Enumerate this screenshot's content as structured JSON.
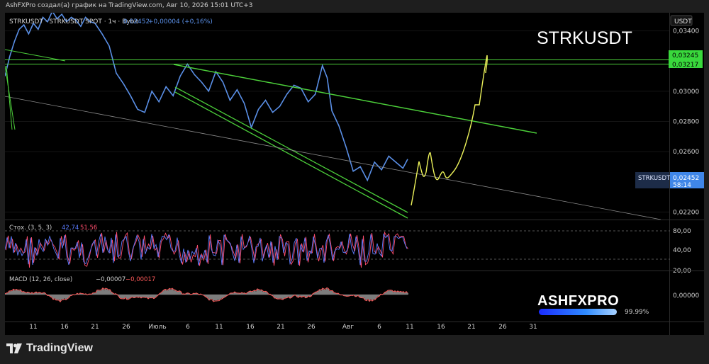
{
  "caption": "AshFXPro создал(а) график на TradingView.com, Авг 10, 2026 15:01 UTC+3",
  "header": {
    "symbol": "STRKUSDT · STRKUSDT SPOT · 1ч · Bybit",
    "last": "0,02452",
    "change": "+0,00004 (+0,16%)"
  },
  "big_title": "STRKUSDT",
  "currency": "USDT",
  "price_badge": {
    "symbol": "STRKUSDT",
    "price": "0,02452",
    "countdown": "58:14"
  },
  "level_labels": [
    "0,03245",
    "0,03217"
  ],
  "stoch": {
    "label": "Стох. (3, 5, 3)",
    "k": "42,74",
    "d": "51,56",
    "levels": [
      "80,00",
      "40,00",
      "20,00"
    ]
  },
  "macd": {
    "label": "MACD (12, 26, close)",
    "v1": "−0,00007",
    "v2": "−0,00017",
    "levels": [
      "0,00000"
    ]
  },
  "brand": {
    "text": "ASHFXPRO",
    "pct": "99.99%"
  },
  "logo_text": "TradingView",
  "colors": {
    "price": "#5a8fe6",
    "trend": "#4ccf3a",
    "projection": "#ecf25a",
    "stoch_k": "#5b7cff",
    "stoch_d": "#ff4d6d",
    "macd": "#ff5a5a"
  },
  "chart_data": {
    "type": "line",
    "title": "STRKUSDT",
    "x_ticks": [
      "11",
      "16",
      "21",
      "26",
      "Июль",
      "6",
      "11",
      "16",
      "21",
      "26",
      "Авг",
      "6",
      "11",
      "16",
      "21",
      "26",
      "31"
    ],
    "y_ticks": [
      0.034,
      0.03,
      0.028,
      0.026,
      0.022
    ],
    "y_tick_labels": [
      "0,03400",
      "0,03000",
      "0,02800",
      "0,02600",
      "0,02200"
    ],
    "ylim": [
      0.0215,
      0.0352
    ],
    "xlim": [
      0,
      34
    ],
    "series": [
      {
        "values": [
          [
            0,
            0.031
          ],
          [
            0.4,
            0.0323
          ],
          [
            0.8,
            0.0333
          ],
          [
            1.2,
            0.0341
          ],
          [
            1.6,
            0.0344
          ],
          [
            2,
            0.0338
          ],
          [
            2.4,
            0.0345
          ],
          [
            2.8,
            0.0341
          ],
          [
            3.2,
            0.0349
          ],
          [
            3.6,
            0.0346
          ],
          [
            4,
            0.0353
          ],
          [
            4.4,
            0.0348
          ],
          [
            4.8,
            0.0351
          ],
          [
            5.2,
            0.0346
          ],
          [
            5.6,
            0.0349
          ],
          [
            6,
            0.0347
          ],
          [
            6.4,
            0.0343
          ],
          [
            6.8,
            0.0349
          ],
          [
            7.2,
            0.0346
          ],
          [
            7.6,
            0.0345
          ],
          [
            8.2,
            0.0338
          ],
          [
            8.8,
            0.033
          ],
          [
            9.4,
            0.0312
          ],
          [
            10,
            0.0305
          ],
          [
            10.6,
            0.0297
          ],
          [
            11.2,
            0.0288
          ],
          [
            11.8,
            0.0286
          ],
          [
            12.4,
            0.03
          ],
          [
            13,
            0.0293
          ],
          [
            13.6,
            0.0303
          ],
          [
            14.2,
            0.0297
          ],
          [
            14.8,
            0.031
          ],
          [
            15.4,
            0.0318
          ],
          [
            16,
            0.0311
          ],
          [
            16.6,
            0.0306
          ],
          [
            17.2,
            0.03
          ],
          [
            17.8,
            0.0313
          ],
          [
            18.4,
            0.0306
          ],
          [
            19,
            0.0294
          ],
          [
            19.6,
            0.0301
          ],
          [
            20.2,
            0.0292
          ],
          [
            20.8,
            0.0276
          ],
          [
            21.4,
            0.0288
          ],
          [
            22,
            0.0294
          ],
          [
            22.6,
            0.0286
          ],
          [
            23.2,
            0.029
          ],
          [
            23.8,
            0.0298
          ],
          [
            24.4,
            0.0304
          ],
          [
            25,
            0.0302
          ],
          [
            25.6,
            0.0293
          ],
          [
            26.2,
            0.0298
          ],
          [
            26.8,
            0.0317
          ],
          [
            27.2,
            0.0309
          ],
          [
            27.6,
            0.0287
          ],
          [
            28.2,
            0.0277
          ],
          [
            28.8,
            0.0263
          ],
          [
            29.4,
            0.0247
          ],
          [
            30,
            0.025
          ],
          [
            30.6,
            0.0241
          ],
          [
            31.2,
            0.0253
          ],
          [
            31.8,
            0.0248
          ],
          [
            32.4,
            0.0257
          ],
          [
            33,
            0.0253
          ],
          [
            33.6,
            0.0249
          ],
          [
            34,
            0.0255
          ]
        ]
      }
    ]
  }
}
